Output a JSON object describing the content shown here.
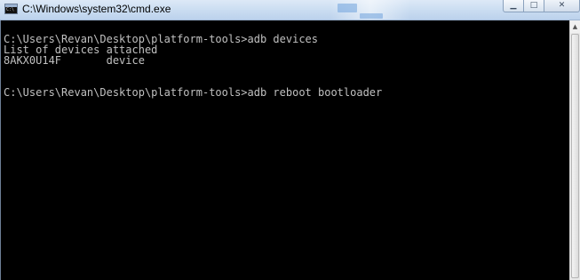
{
  "window": {
    "title": "C:\\Windows\\system32\\cmd.exe",
    "app_icon": "cmd-console-icon",
    "controls": {
      "minimize_glyph": "▁",
      "maximize_glyph": "□",
      "close_glyph": "✕"
    }
  },
  "console": {
    "background": "#000000",
    "foreground": "#c0c0c0",
    "lines": [
      "C:\\Users\\Revan\\Desktop\\platform-tools>adb devices",
      "List of devices attached",
      "8AKX0U14F       device",
      "",
      "",
      "C:\\Users\\Revan\\Desktop\\platform-tools>adb reboot bootloader"
    ]
  },
  "scrollbar": {
    "up_glyph": "▲",
    "down_glyph": "▼"
  }
}
